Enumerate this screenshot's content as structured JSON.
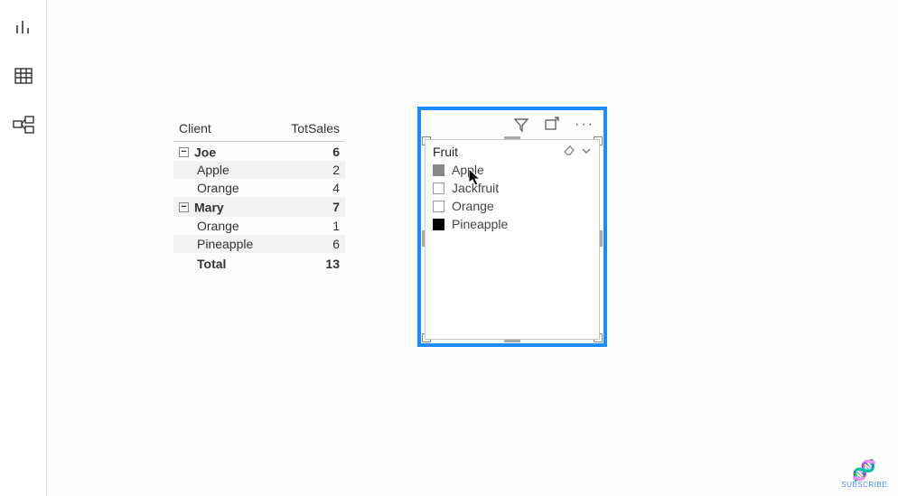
{
  "sidebar": {
    "icons": [
      "report-icon",
      "data-icon",
      "model-icon"
    ]
  },
  "matrix": {
    "headers": {
      "col1": "Client",
      "col2": "TotSales"
    },
    "groups": [
      {
        "name": "Joe",
        "total": 6,
        "rows": [
          {
            "label": "Apple",
            "value": 2
          },
          {
            "label": "Orange",
            "value": 4
          }
        ]
      },
      {
        "name": "Mary",
        "total": 7,
        "rows": [
          {
            "label": "Orange",
            "value": 1
          },
          {
            "label": "Pineapple",
            "value": 6
          }
        ]
      }
    ],
    "total_label": "Total",
    "total_value": 13
  },
  "slicer": {
    "title": "Fruit",
    "items": [
      {
        "label": "Apple",
        "state": "sel-gray"
      },
      {
        "label": "Jackfruit",
        "state": ""
      },
      {
        "label": "Orange",
        "state": ""
      },
      {
        "label": "Pineapple",
        "state": "sel-black"
      }
    ]
  },
  "subscribe_label": "SUBSCRIBE"
}
